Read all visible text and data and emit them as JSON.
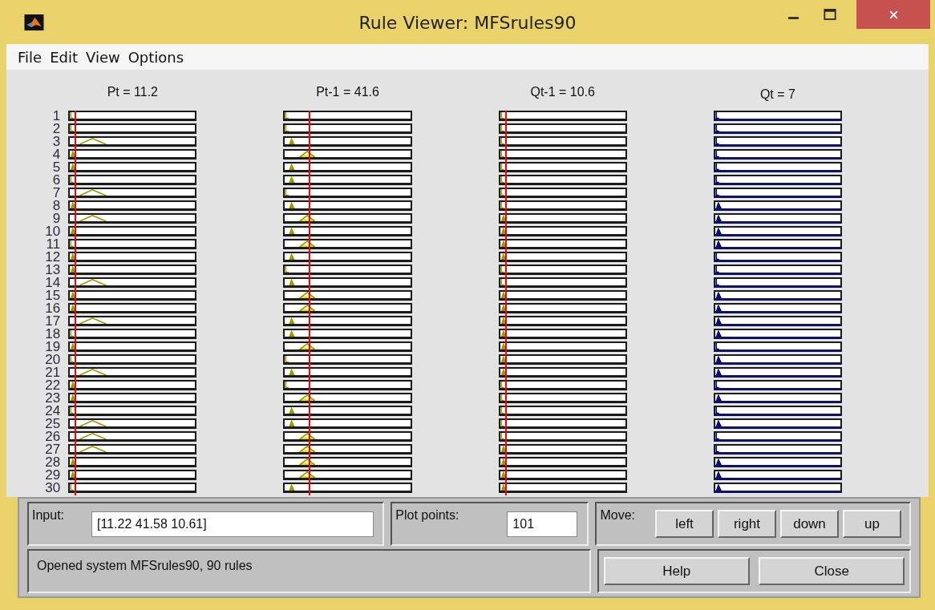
{
  "window": {
    "title": "Rule Viewer: MFSrules90"
  },
  "menu": [
    "File",
    "Edit",
    "View",
    "Options"
  ],
  "columns": [
    {
      "header": "Pt = 11.2",
      "kind": "input",
      "level": 0.05
    },
    {
      "header": "Pt-1 = 41.6",
      "kind": "input",
      "level": 0.2
    },
    {
      "header": "Qt-1 = 10.6",
      "kind": "input",
      "level": 0.05
    },
    {
      "header": "Qt = 7",
      "kind": "output"
    }
  ],
  "rules": [
    "1",
    "2",
    "3",
    "4",
    "5",
    "6",
    "7",
    "8",
    "9",
    "10",
    "11",
    "12",
    "13",
    "14",
    "15",
    "16",
    "17",
    "18",
    "19",
    "20",
    "21",
    "22",
    "23",
    "24",
    "25",
    "26",
    "27",
    "28",
    "29",
    "30"
  ],
  "input": {
    "label": "Input:",
    "value": "[11.22 41.58 10.61]"
  },
  "plot_points": {
    "label": "Plot points:",
    "value": "101"
  },
  "move": {
    "label": "Move:",
    "buttons": [
      "left",
      "right",
      "down",
      "up"
    ]
  },
  "status": "Opened system MFSrules90, 90 rules",
  "buttons": [
    "Help",
    "Close"
  ]
}
